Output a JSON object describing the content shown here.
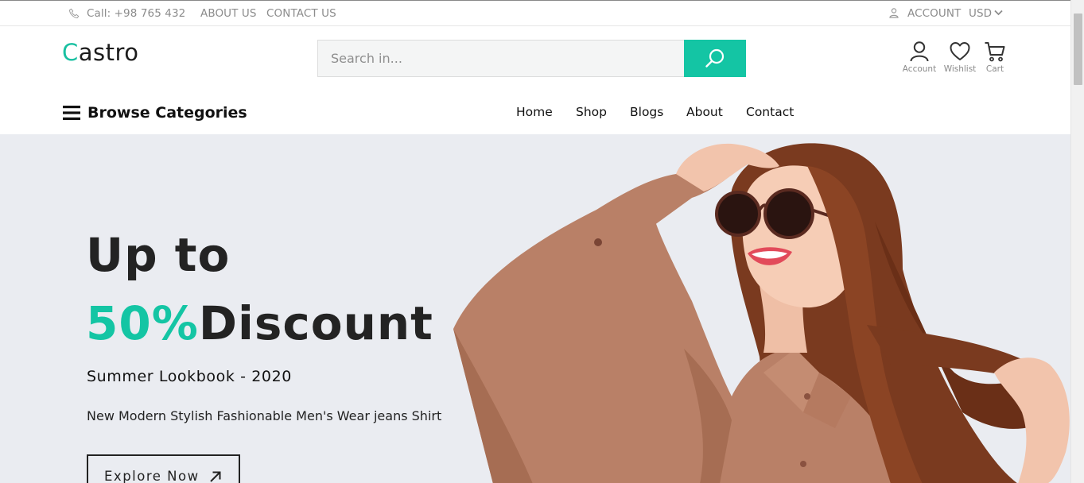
{
  "topbar": {
    "phone": "Call: +98 765 432",
    "about": "ABOUT US",
    "contact": "CONTACT US",
    "account": "ACCOUNT",
    "currency": "USD"
  },
  "header": {
    "logo_first": "C",
    "logo_rest": "astro",
    "search_placeholder": "Search in...",
    "icons": {
      "account": "Account",
      "wishlist": "Wishlist",
      "cart": "Cart"
    }
  },
  "nav": {
    "browse": "Browse Categories",
    "links": [
      "Home",
      "Shop",
      "Blogs",
      "About",
      "Contact"
    ]
  },
  "hero": {
    "line1": "Up to",
    "discount_percent": "50%",
    "discount_word": "Discount",
    "subtitle": "Summer Lookbook - 2020",
    "description": "New Modern Stylish Fashionable Men's Wear jeans Shirt",
    "cta": "Explore Now"
  },
  "colors": {
    "accent": "#14c5a4",
    "hero_bg": "#eaecf1"
  }
}
